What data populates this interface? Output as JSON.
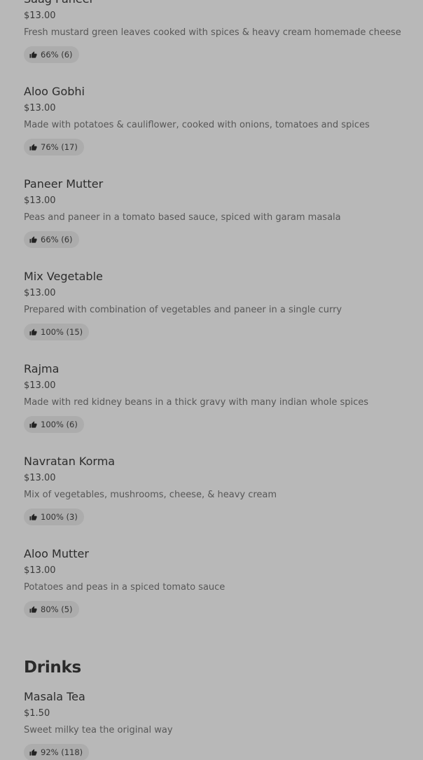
{
  "items": [
    {
      "name": "Saag Paneer",
      "price": "$13.00",
      "description": "Fresh mustard green leaves cooked with spices & heavy cream homemade cheese",
      "rating": "66% (6)"
    },
    {
      "name": "Aloo Gobhi",
      "price": "$13.00",
      "description": "Made with potatoes & cauliflower, cooked with onions, tomatoes and spices",
      "rating": "76% (17)"
    },
    {
      "name": "Paneer Mutter",
      "price": "$13.00",
      "description": "Peas and paneer in a tomato based sauce, spiced with garam masala",
      "rating": "66% (6)"
    },
    {
      "name": "Mix Vegetable",
      "price": "$13.00",
      "description": "Prepared with combination of vegetables and paneer in a single curry",
      "rating": "100% (15)"
    },
    {
      "name": "Rajma",
      "price": "$13.00",
      "description": "Made with red kidney beans in a thick gravy with many indian whole spices",
      "rating": "100% (6)"
    },
    {
      "name": "Navratan Korma",
      "price": "$13.00",
      "description": "Mix of vegetables, mushrooms, cheese, & heavy cream",
      "rating": "100% (3)"
    },
    {
      "name": "Aloo Mutter",
      "price": "$13.00",
      "description": "Potatoes and peas in a spiced tomato sauce",
      "rating": "80% (5)"
    }
  ],
  "drinks": {
    "title": "Drinks",
    "items": [
      {
        "name": "Masala Tea",
        "price": "$1.50",
        "description": "Sweet milky tea the original way",
        "rating": "92% (118)"
      }
    ]
  },
  "icons": {
    "rating": "thumbs-up-icon"
  },
  "colors": {
    "background": "#b8b8b8",
    "pill": "#acacac",
    "text": "#2f2f2f",
    "muted": "#575757"
  }
}
